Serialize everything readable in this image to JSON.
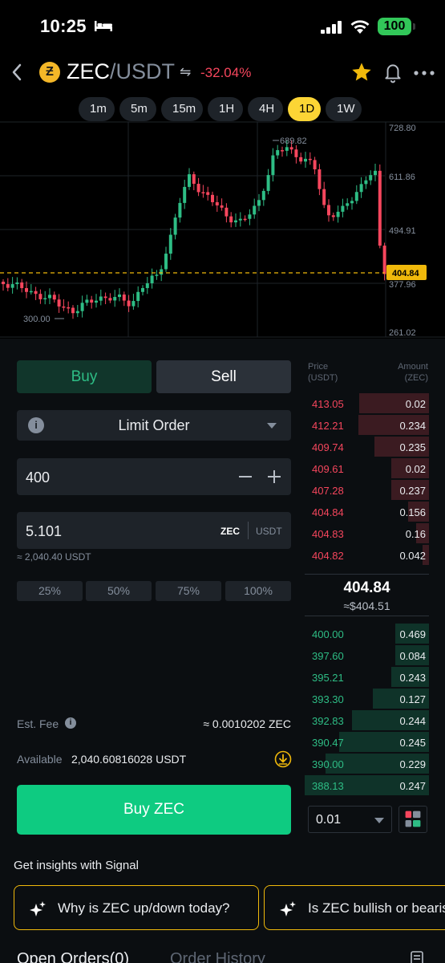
{
  "status_bar": {
    "time": "10:25",
    "battery": "100"
  },
  "header": {
    "base": "ZEC",
    "separator": "/",
    "quote": "USDT",
    "change": "-32.04%"
  },
  "chart": {
    "timeframes": [
      "1m",
      "5m",
      "15m",
      "1H",
      "4H",
      "1D",
      "1W"
    ],
    "active_timeframe": "1D",
    "price_ticks": [
      "728.80",
      "611.86",
      "494.91",
      "377.96",
      "261.02"
    ],
    "high_label": "689.82",
    "low_label": "300.00",
    "current_price": "404.84"
  },
  "order_form": {
    "buy_tab": "Buy",
    "sell_tab": "Sell",
    "order_type": "Limit Order",
    "price": "400",
    "amount": "5.101",
    "unit_base": "ZEC",
    "unit_quote": "USDT",
    "approx_total": "≈ 2,040.40 USDT",
    "percentages": [
      "25%",
      "50%",
      "75%",
      "100%"
    ],
    "fee_label": "Est. Fee",
    "fee_value": "≈ 0.0010202 ZEC",
    "available_label": "Available",
    "available_value": "2,040.60816028 USDT",
    "submit_label": "Buy ZEC"
  },
  "order_book": {
    "header_price": [
      "Price",
      "(USDT)"
    ],
    "header_amount": [
      "Amount",
      "(ZEC)"
    ],
    "asks": [
      {
        "price": "413.05",
        "amount": "0.02",
        "depth": 0.56
      },
      {
        "price": "412.21",
        "amount": "0.234",
        "depth": 0.57
      },
      {
        "price": "409.74",
        "amount": "0.235",
        "depth": 0.44
      },
      {
        "price": "409.61",
        "amount": "0.02",
        "depth": 0.3
      },
      {
        "price": "407.28",
        "amount": "0.237",
        "depth": 0.3
      },
      {
        "price": "404.84",
        "amount": "0.156",
        "depth": 0.17
      },
      {
        "price": "404.83",
        "amount": "0.16",
        "depth": 0.1
      },
      {
        "price": "404.82",
        "amount": "0.042",
        "depth": 0.05
      }
    ],
    "mid_price": "404.84",
    "mid_price_usd": "≈$404.51",
    "bids": [
      {
        "price": "400.00",
        "amount": "0.469",
        "depth": 0.27
      },
      {
        "price": "397.60",
        "amount": "0.084",
        "depth": 0.27
      },
      {
        "price": "395.21",
        "amount": "0.243",
        "depth": 0.3
      },
      {
        "price": "393.30",
        "amount": "0.127",
        "depth": 0.45
      },
      {
        "price": "392.83",
        "amount": "0.244",
        "depth": 0.62
      },
      {
        "price": "390.47",
        "amount": "0.245",
        "depth": 0.72
      },
      {
        "price": "390.00",
        "amount": "0.229",
        "depth": 0.83
      },
      {
        "price": "388.13",
        "amount": "0.247",
        "depth": 1.0
      }
    ],
    "depth_step": "0.01"
  },
  "signal": {
    "title": "Get insights with Signal",
    "chips": [
      "Why is ZEC up/down today?",
      "Is ZEC bullish or bearish?"
    ]
  },
  "tabs": [
    "Open Orders(0)",
    "Order History"
  ],
  "colors": {
    "up": "#2ebd85",
    "down": "#f6465d",
    "accent": "#fcd535",
    "buy": "#0ecb81"
  }
}
